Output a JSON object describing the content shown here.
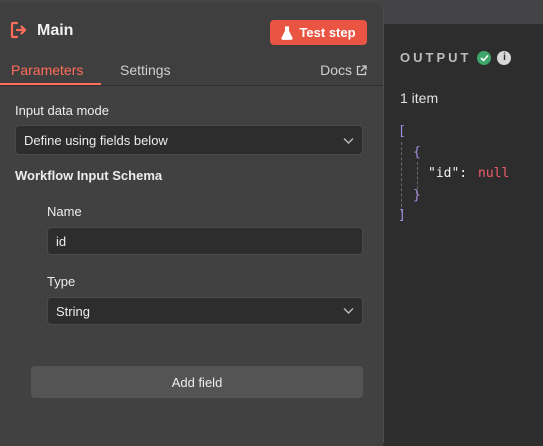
{
  "node": {
    "title": "Main",
    "test_button_label": "Test step",
    "icon": "sign-out-icon"
  },
  "tabs": {
    "parameters": "Parameters",
    "settings": "Settings",
    "docs": "Docs"
  },
  "form": {
    "input_mode_label": "Input data mode",
    "input_mode_value": "Define using fields below",
    "schema_label": "Workflow Input Schema",
    "name_label": "Name",
    "name_value": "id",
    "type_label": "Type",
    "type_value": "String",
    "add_field_label": "Add field"
  },
  "output": {
    "title": "OUTPUT",
    "count": "1 item",
    "json": {
      "open_array": "[",
      "open_obj": "{",
      "key": "\"id\":",
      "value": "null",
      "close_obj": "}",
      "close_array": "]"
    }
  },
  "colors": {
    "accent": "#ff6d5a",
    "button": "#ea5443",
    "success": "#3ea56b",
    "json_bracket": "#a58de0",
    "json_null": "#f05d6b"
  }
}
